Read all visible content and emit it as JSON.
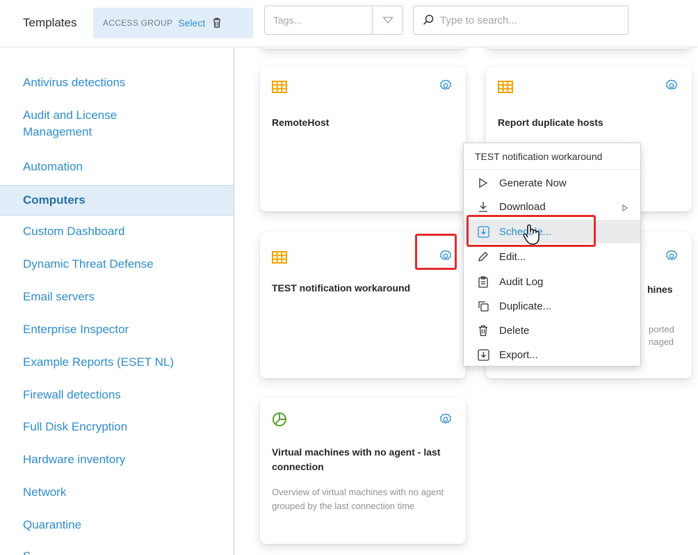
{
  "toolbar": {
    "templates_label": "Templates",
    "access_group_label": "ACCESS GROUP",
    "select_label": "Select",
    "tags_placeholder": "Tags...",
    "search_placeholder": "Type to search..."
  },
  "sidebar": {
    "items": [
      {
        "label": "Antivirus detections"
      },
      {
        "label": "Audit and License\nManagement"
      },
      {
        "label": "Automation"
      },
      {
        "label": "Computers",
        "active": true
      },
      {
        "label": "Custom Dashboard"
      },
      {
        "label": "Dynamic Threat Defense"
      },
      {
        "label": "Email servers"
      },
      {
        "label": "Enterprise Inspector"
      },
      {
        "label": "Example Reports (ESET NL)"
      },
      {
        "label": "Firewall detections"
      },
      {
        "label": "Full Disk Encryption"
      },
      {
        "label": "Hardware inventory"
      },
      {
        "label": "Network"
      },
      {
        "label": "Quarantine"
      },
      {
        "label": "S..."
      }
    ]
  },
  "cards": [
    {
      "title": "RemoteHost",
      "icon": "table-icon"
    },
    {
      "title": "Report duplicate hosts",
      "icon": "table-icon"
    },
    {
      "title": "TEST notification workaround",
      "icon": "table-icon"
    },
    {
      "title": "hines",
      "desc_line1": "ported",
      "desc_line2": "naged",
      "icon": "gear-icon"
    },
    {
      "title": "Virtual machines with no agent - last connection",
      "description": "Overview of virtual machines with no agent grouped by the last connection time",
      "icon": "pie-chart-icon"
    }
  ],
  "context_menu": {
    "header": "TEST notification workaround",
    "items": [
      {
        "label": "Generate Now",
        "icon": "play-icon"
      },
      {
        "label": "Download",
        "icon": "download-icon",
        "submenu": true
      },
      {
        "label": "Schedule...",
        "icon": "schedule-icon",
        "highlighted": true
      },
      {
        "label": "Edit...",
        "icon": "pencil-icon"
      },
      {
        "label": "Audit Log",
        "icon": "clipboard-icon"
      },
      {
        "label": "Duplicate...",
        "icon": "duplicate-icon"
      },
      {
        "label": "Delete",
        "icon": "trash-icon"
      },
      {
        "label": "Export...",
        "icon": "export-icon"
      }
    ]
  },
  "colors": {
    "accent": "#2e8ccf",
    "table_icon": "#f0a500",
    "pie_icon": "#5aa02c",
    "highlight_border": "#e32b2b",
    "sidebar_active_bg": "#e1eef9"
  }
}
